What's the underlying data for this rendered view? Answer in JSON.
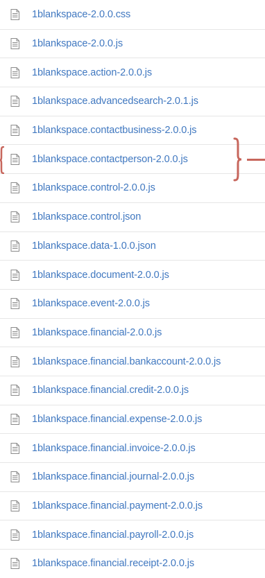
{
  "files": [
    {
      "name": "1blankspace-2.0.0.css"
    },
    {
      "name": "1blankspace-2.0.0.js"
    },
    {
      "name": "1blankspace.action-2.0.0.js"
    },
    {
      "name": "1blankspace.advancedsearch-2.0.1.js"
    },
    {
      "name": "1blankspace.contactbusiness-2.0.0.js"
    },
    {
      "name": "1blankspace.contactperson-2.0.0.js",
      "highlighted": true
    },
    {
      "name": "1blankspace.control-2.0.0.js"
    },
    {
      "name": "1blankspace.control.json"
    },
    {
      "name": "1blankspace.data-1.0.0.json"
    },
    {
      "name": "1blankspace.document-2.0.0.js"
    },
    {
      "name": "1blankspace.event-2.0.0.js"
    },
    {
      "name": "1blankspace.financial-2.0.0.js"
    },
    {
      "name": "1blankspace.financial.bankaccount-2.0.0.js"
    },
    {
      "name": "1blankspace.financial.credit-2.0.0.js"
    },
    {
      "name": "1blankspace.financial.expense-2.0.0.js"
    },
    {
      "name": "1blankspace.financial.invoice-2.0.0.js"
    },
    {
      "name": "1blankspace.financial.journal-2.0.0.js"
    },
    {
      "name": "1blankspace.financial.payment-2.0.0.js"
    },
    {
      "name": "1blankspace.financial.payroll-2.0.0.js"
    },
    {
      "name": "1blankspace.financial.receipt-2.0.0.js"
    }
  ],
  "icon": "file-icon",
  "colors": {
    "link": "#4078c0",
    "annotation": "#c7665c",
    "divider": "#e6e6e6"
  }
}
